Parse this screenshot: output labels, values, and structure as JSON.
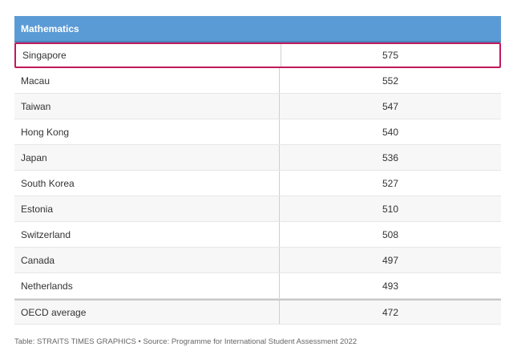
{
  "chart_data": {
    "type": "table",
    "header": "Mathematics",
    "rows": [
      {
        "name": "Singapore",
        "value": 575,
        "highlighted": true
      },
      {
        "name": "Macau",
        "value": 552
      },
      {
        "name": "Taiwan",
        "value": 547
      },
      {
        "name": "Hong Kong",
        "value": 540
      },
      {
        "name": "Japan",
        "value": 536
      },
      {
        "name": "South Korea",
        "value": 527
      },
      {
        "name": "Estonia",
        "value": 510
      },
      {
        "name": "Switzerland",
        "value": 508
      },
      {
        "name": "Canada",
        "value": 497
      },
      {
        "name": "Netherlands",
        "value": 493
      },
      {
        "name": "OECD average",
        "value": 472
      }
    ]
  },
  "caption": "Table: STRAITS TIMES GRAPHICS • Source: Programme for International Student Assessment 2022",
  "colors": {
    "header_bg": "#5b9bd5",
    "highlight_border": "#c2185b"
  }
}
